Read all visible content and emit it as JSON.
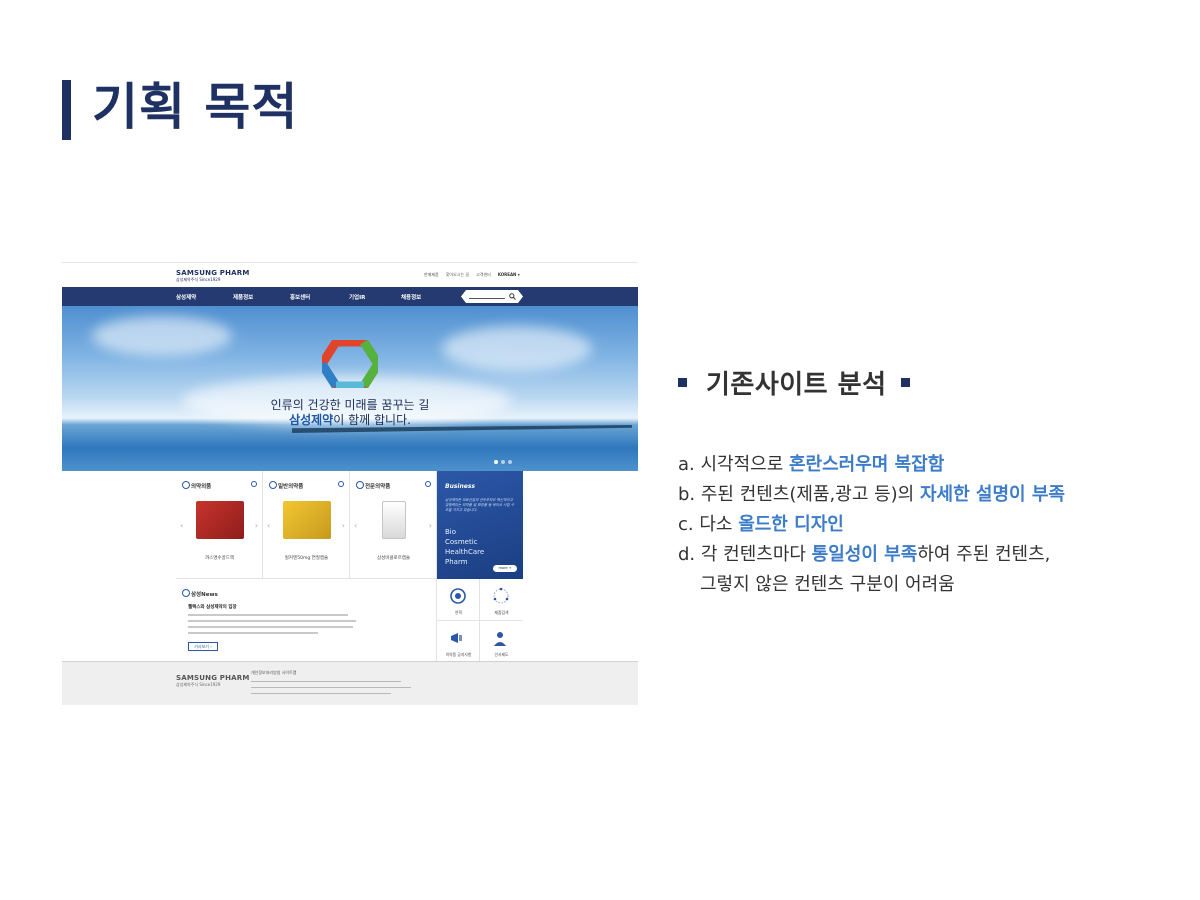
{
  "slide": {
    "title": "기획 목적",
    "accent_color": "#1f3163",
    "highlight_color": "#3d7cc9"
  },
  "screenshot": {
    "logo": {
      "name": "SAMSUNG PHARM",
      "sub": "삼성제약주식 Since1929"
    },
    "util_links": [
      "판매제품",
      "찾아오시는 길",
      "고객센터",
      "KOREAN ▾"
    ],
    "nav": [
      "삼성제약",
      "제품정보",
      "홍보센터",
      "기업IR",
      "채용정보"
    ],
    "hero": {
      "line1": "인류의 건강한 미래를 꿈꾸는 길",
      "brand": "삼성제약",
      "line2_rest": "이 함께 합니다."
    },
    "products": [
      {
        "heading": "의약외품",
        "name": "까스명수골드액"
      },
      {
        "heading": "일반의약품",
        "name": "헐커텐50mg 연질캡슐"
      },
      {
        "heading": "전문의약품",
        "name": "삼성비클로르캡슐"
      }
    ],
    "business": {
      "title": "Business",
      "desc": "삼성제약은 의료산업의 선두주자로 혁신적이고 경쟁력있는 의약품 및 화장품 등 바이오 사업 구조를 가지고 있습니다.",
      "words": [
        "Bio",
        "Cosmetic",
        "HealthCare",
        "Pharm"
      ],
      "more": "more +"
    },
    "news": {
      "heading": "삼성News",
      "title": "젤렉스와 삼성제약의 입장",
      "button": "기사보기 ›"
    },
    "quick": [
      "연혁",
      "제품검색",
      "의약품 공지사항",
      "인사제도"
    ],
    "footer": {
      "logo": "SAMSUNG PHARM",
      "logo_sub": "삼성제약주식 Since1929",
      "links": "개인정보처리방침    사이트맵"
    }
  },
  "analysis": {
    "heading": "기존사이트 분석",
    "items": [
      {
        "prefix": "a. 시각적으로 ",
        "highlight": "혼란스러우며 복잡함",
        "suffix": ""
      },
      {
        "prefix": "b. 주된 컨텐츠(제품,광고 등)의 ",
        "highlight": "자세한 설명이 부족",
        "suffix": ""
      },
      {
        "prefix": "c. 다소 ",
        "highlight": "올드한 디자인",
        "suffix": ""
      },
      {
        "prefix": "d. 각 컨텐츠마다 ",
        "highlight": "통일성이 부족",
        "suffix": "하여 주된 컨텐츠,"
      }
    ],
    "continuation": "그렇지 않은 컨텐츠 구분이 어려움"
  }
}
